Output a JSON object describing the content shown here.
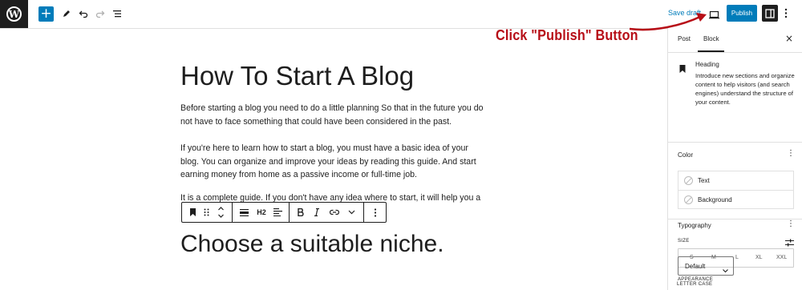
{
  "topbar": {
    "save_draft": "Save draft",
    "publish": "Publish"
  },
  "annotation": {
    "text": "Click \"Publish\" Button",
    "color": "#b70e17"
  },
  "editor": {
    "title": "How To Start A Blog",
    "paragraphs": [
      "Before starting a blog you need to do a little planning So that in the future you do not have to face something that could have been considered in the past.",
      "If you're here to learn how to start a blog, you must have a basic idea of your blog. You can organize and improve your ideas by reading this guide. And start earning money from home as a passive income or full-time job.",
      "It is a complete guide. If you don't have any idea where to start, it will help you a"
    ],
    "heading2": "Choose a suitable niche."
  },
  "block_toolbar": {
    "heading_level": "H2"
  },
  "sidebar": {
    "tabs": [
      "Post",
      "Block"
    ],
    "active_tab": "Block",
    "block": {
      "name": "Heading",
      "description": "Introduce new sections and organize content to help visitors (and search engines) understand the structure of your content."
    },
    "color": {
      "title": "Color",
      "items": [
        "Text",
        "Background"
      ]
    },
    "typography": {
      "title": "Typography",
      "size_label": "SIZE",
      "sizes": [
        "S",
        "M",
        "L",
        "XL",
        "XXL"
      ],
      "appearance_label": "APPEARANCE",
      "appearance_value": "Default",
      "letter_case_label": "LETTER CASE"
    }
  },
  "colors": {
    "accent": "#007cba",
    "dark": "#1e1e1e"
  }
}
